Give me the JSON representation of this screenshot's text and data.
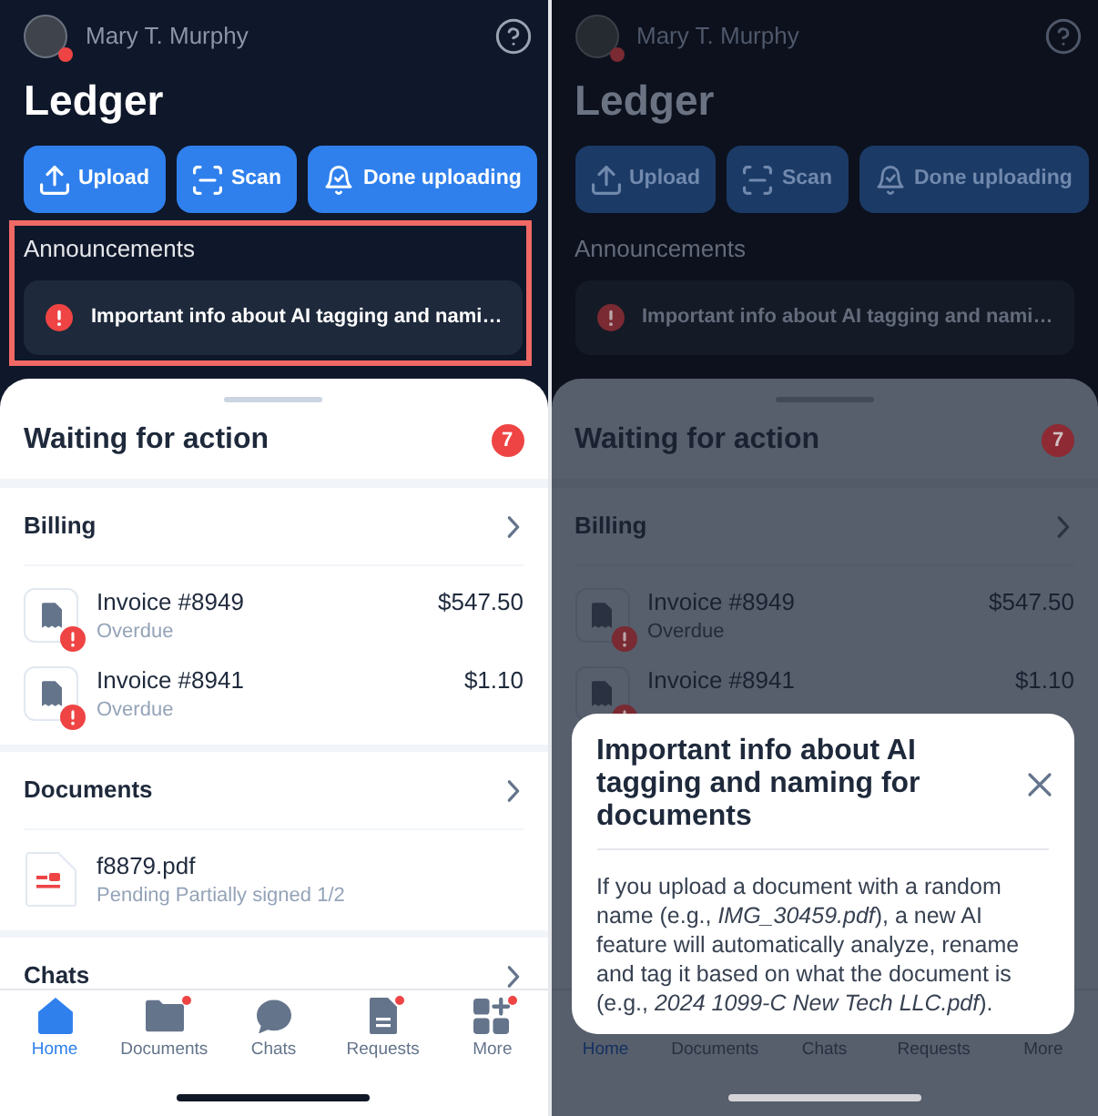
{
  "screens": [
    {
      "dimmed": false,
      "header": {
        "user_name": "Mary T. Murphy",
        "avatar_badge": true
      },
      "title": "Ledger",
      "actions": [
        {
          "label": "Upload"
        },
        {
          "label": "Scan"
        },
        {
          "label": "Done uploading"
        }
      ],
      "announcements": {
        "heading": "Announcements",
        "highlighted": true,
        "items": [
          {
            "text": "Important info about AI tagging and nami…"
          }
        ]
      },
      "sheet": {
        "title": "Waiting for action",
        "count": "7",
        "sections": [
          {
            "title": "Billing",
            "items": [
              {
                "kind": "invoice",
                "name": "Invoice #8949",
                "status": "Overdue",
                "amount": "$547.50",
                "alert": true
              },
              {
                "kind": "invoice",
                "name": "Invoice #8941",
                "status": "Overdue",
                "amount": "$1.10",
                "alert": true
              }
            ]
          },
          {
            "title": "Documents",
            "items": [
              {
                "kind": "pdf",
                "name": "f8879.pdf",
                "status": "Pending Partially signed 1/2"
              }
            ]
          },
          {
            "title": "Chats"
          }
        ]
      },
      "nav": [
        {
          "label": "Home",
          "selected": true,
          "badge": false
        },
        {
          "label": "Documents",
          "selected": false,
          "badge": true
        },
        {
          "label": "Chats",
          "selected": false,
          "badge": false
        },
        {
          "label": "Requests",
          "selected": false,
          "badge": true
        },
        {
          "label": "More",
          "selected": false,
          "badge": true
        }
      ]
    },
    {
      "dimmed": true,
      "header": {
        "user_name": "Mary T. Murphy",
        "avatar_badge": true
      },
      "title": "Ledger",
      "actions": [
        {
          "label": "Upload"
        },
        {
          "label": "Scan"
        },
        {
          "label": "Done uploading"
        }
      ],
      "announcements": {
        "heading": "Announcements",
        "highlighted": false,
        "items": [
          {
            "text": "Important info about AI tagging and nami…"
          }
        ]
      },
      "sheet": {
        "title": "Waiting for action",
        "count": "7",
        "sections": [
          {
            "title": "Billing",
            "items": [
              {
                "kind": "invoice",
                "name": "Invoice #8949",
                "status": "Overdue",
                "amount": "$547.50",
                "alert": true
              },
              {
                "kind": "invoice",
                "name": "Invoice #8941",
                "amount": "$1.10",
                "alert": true
              }
            ]
          }
        ]
      },
      "nav": [
        {
          "label": "Home",
          "selected": true
        },
        {
          "label": "Documents",
          "selected": false
        },
        {
          "label": "Chats",
          "selected": false
        },
        {
          "label": "Requests",
          "selected": false
        },
        {
          "label": "More",
          "selected": false
        }
      ],
      "dialog": {
        "title": "Important info about AI tagging and naming for documents",
        "body": "If you upload a document with a random name (e.g., *IMG_30459.pdf*), a new AI feature will automatically analyze, rename and tag it based on what the document is (e.g., *2024 1099-C New Tech LLC.pdf*)."
      }
    }
  ]
}
